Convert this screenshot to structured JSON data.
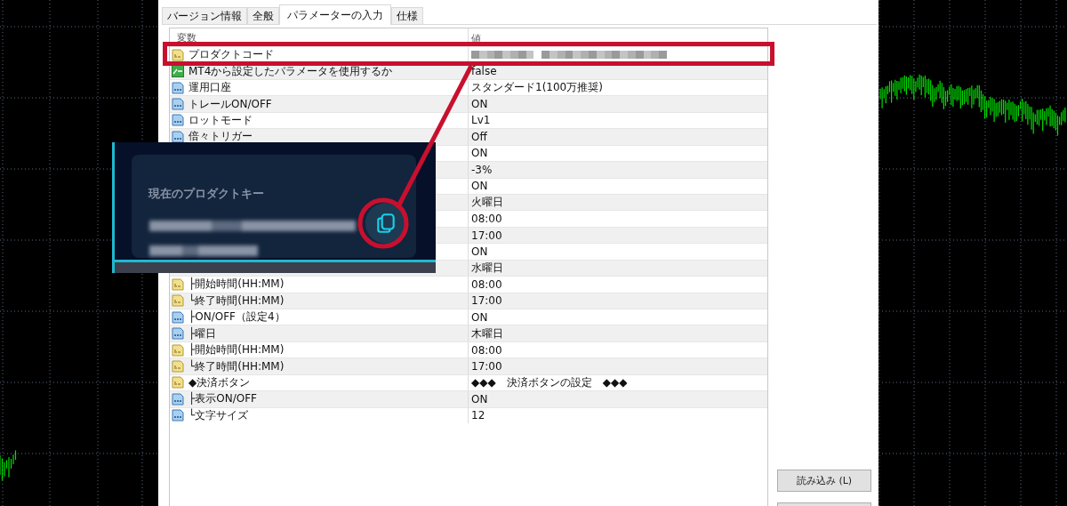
{
  "dialog": {
    "tabs": [
      {
        "label": "バージョン情報",
        "selected": false
      },
      {
        "label": "全般",
        "selected": false
      },
      {
        "label": "パラメーターの入力",
        "selected": true
      },
      {
        "label": "仕様",
        "selected": false
      }
    ],
    "table": {
      "columns": [
        "変数",
        "値"
      ],
      "rows": [
        {
          "kind": "string",
          "label": "プロダクトコード"
        },
        {
          "kind": "bool",
          "label": "MT4から設定したパラメータを使用するか",
          "value": "false"
        },
        {
          "kind": "int",
          "label": "運用口座",
          "value": "スタンダード1(100万推奨)"
        },
        {
          "kind": "int",
          "label": "トレールON/OFF",
          "value": "ON"
        },
        {
          "kind": "int",
          "label": "ロットモード",
          "value": "Lv1"
        },
        {
          "kind": "int",
          "label": "倍々トリガー",
          "value": "Off"
        },
        {
          "value": "ON"
        },
        {
          "value": "-3%"
        },
        {
          "value": "ON"
        },
        {
          "value": "火曜日"
        },
        {
          "value": "08:00"
        },
        {
          "value": "17:00"
        },
        {
          "value": "ON"
        },
        {
          "value": "水曜日"
        },
        {
          "kind": "string",
          "label": "├開始時間(HH:MM)",
          "value": "08:00"
        },
        {
          "kind": "string",
          "label": "└終了時間(HH:MM)",
          "value": "17:00"
        },
        {
          "kind": "int",
          "label": "├ON/OFF（設定4）",
          "value": "ON"
        },
        {
          "kind": "int",
          "label": "├曜日",
          "value": "木曜日"
        },
        {
          "kind": "string",
          "label": "├開始時間(HH:MM)",
          "value": "08:00"
        },
        {
          "kind": "string",
          "label": "└終了時間(HH:MM)",
          "value": "17:00"
        },
        {
          "kind": "string",
          "label": "◆決済ボタン",
          "value": "◆◆◆　決済ボタンの設定　◆◆◆"
        },
        {
          "kind": "int",
          "label": "├表示ON/OFF",
          "value": "ON"
        },
        {
          "kind": "int",
          "label": "└文字サイズ",
          "value": "12"
        }
      ]
    },
    "buttons": [
      "読み込み (L)"
    ]
  },
  "overlay": {
    "title": "現在のプロダクトキー"
  }
}
